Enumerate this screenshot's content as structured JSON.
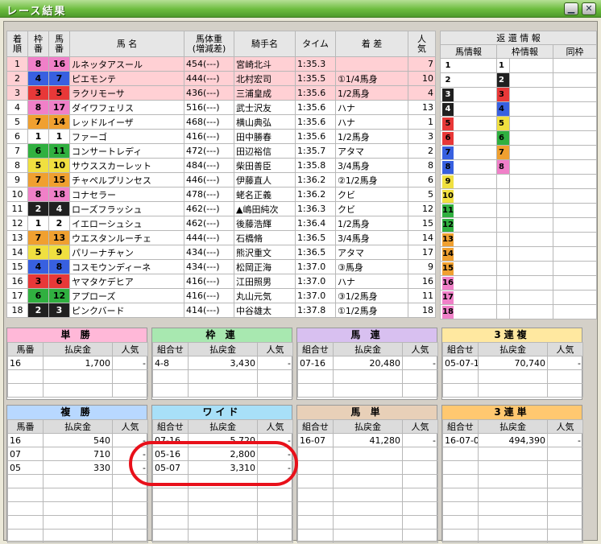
{
  "window": {
    "title": "レース結果",
    "minimize": "▁",
    "close": "✕"
  },
  "results": {
    "headers": {
      "rank": "着\n順",
      "waku": "枠\n番",
      "uma": "馬\n番",
      "name": "馬 名",
      "weight": "馬体重\n(増減差)",
      "jockey": "騎手名",
      "time": "タイム",
      "margin": "着 差",
      "pop": "人\n気"
    },
    "rows": [
      {
        "rank": "1",
        "waku": "8",
        "uma": "16",
        "name": "ルネッタアスール",
        "weight": "454(---)",
        "jockey": "宮崎北斗",
        "time": "1:35.3",
        "margin": "",
        "pop": "7"
      },
      {
        "rank": "2",
        "waku": "4",
        "uma": "7",
        "name": "ピエモンテ",
        "weight": "444(---)",
        "jockey": "北村宏司",
        "time": "1:35.5",
        "margin": "①1/4馬身",
        "pop": "10"
      },
      {
        "rank": "3",
        "waku": "3",
        "uma": "5",
        "name": "ラクリモーサ",
        "weight": "436(---)",
        "jockey": "三浦皇成",
        "time": "1:35.6",
        "margin": "1/2馬身",
        "pop": "4"
      },
      {
        "rank": "4",
        "waku": "8",
        "uma": "17",
        "name": "ダイワフェリス",
        "weight": "516(---)",
        "jockey": "武士沢友",
        "time": "1:35.6",
        "margin": "ハナ",
        "pop": "13"
      },
      {
        "rank": "5",
        "waku": "7",
        "uma": "14",
        "name": "レッドルイーザ",
        "weight": "468(---)",
        "jockey": "横山典弘",
        "time": "1:35.6",
        "margin": "ハナ",
        "pop": "1"
      },
      {
        "rank": "6",
        "waku": "1",
        "uma": "1",
        "name": "ファーゴ",
        "weight": "416(---)",
        "jockey": "田中勝春",
        "time": "1:35.6",
        "margin": "1/2馬身",
        "pop": "3"
      },
      {
        "rank": "7",
        "waku": "6",
        "uma": "11",
        "name": "コンサートレディ",
        "weight": "472(---)",
        "jockey": "田辺裕信",
        "time": "1:35.7",
        "margin": "アタマ",
        "pop": "2"
      },
      {
        "rank": "8",
        "waku": "5",
        "uma": "10",
        "name": "サウススカーレット",
        "weight": "484(---)",
        "jockey": "柴田善臣",
        "time": "1:35.8",
        "margin": "3/4馬身",
        "pop": "8"
      },
      {
        "rank": "9",
        "waku": "7",
        "uma": "15",
        "name": "チャペルプリンセス",
        "weight": "446(---)",
        "jockey": "伊藤直人",
        "time": "1:36.2",
        "margin": "②1/2馬身",
        "pop": "6"
      },
      {
        "rank": "10",
        "waku": "8",
        "uma": "18",
        "name": "コナセラー",
        "weight": "478(---)",
        "jockey": "蛯名正義",
        "time": "1:36.2",
        "margin": "クビ",
        "pop": "5"
      },
      {
        "rank": "11",
        "waku": "2",
        "uma": "4",
        "name": "ローズフラッシュ",
        "weight": "462(---)",
        "jockey": "▲嶋田純次",
        "time": "1:36.3",
        "margin": "クビ",
        "pop": "12"
      },
      {
        "rank": "12",
        "waku": "1",
        "uma": "2",
        "name": "イエローシュシュ",
        "weight": "462(---)",
        "jockey": "後藤浩輝",
        "time": "1:36.4",
        "margin": "1/2馬身",
        "pop": "15"
      },
      {
        "rank": "13",
        "waku": "7",
        "uma": "13",
        "name": "ウエスタンルーチェ",
        "weight": "444(---)",
        "jockey": "石橋脩",
        "time": "1:36.5",
        "margin": "3/4馬身",
        "pop": "14"
      },
      {
        "rank": "14",
        "waku": "5",
        "uma": "9",
        "name": "パリーナチャン",
        "weight": "434(---)",
        "jockey": "熊沢重文",
        "time": "1:36.5",
        "margin": "アタマ",
        "pop": "17"
      },
      {
        "rank": "15",
        "waku": "4",
        "uma": "8",
        "name": "コスモウンディーネ",
        "weight": "434(---)",
        "jockey": "松岡正海",
        "time": "1:37.0",
        "margin": "③馬身",
        "pop": "9"
      },
      {
        "rank": "16",
        "waku": "3",
        "uma": "6",
        "name": "ヤマタケデヒア",
        "weight": "416(---)",
        "jockey": "江田照男",
        "time": "1:37.0",
        "margin": "ハナ",
        "pop": "16"
      },
      {
        "rank": "17",
        "waku": "6",
        "uma": "12",
        "name": "アプローズ",
        "weight": "416(---)",
        "jockey": "丸山元気",
        "time": "1:37.0",
        "margin": "③1/2馬身",
        "pop": "11"
      },
      {
        "rank": "18",
        "waku": "2",
        "uma": "3",
        "name": "ピンクバード",
        "weight": "414(---)",
        "jockey": "中谷雄太",
        "time": "1:37.8",
        "margin": "①1/2馬身",
        "pop": "18"
      }
    ]
  },
  "return_info": {
    "title": "返 還 情 報",
    "col_horse": "馬情報",
    "col_waku": "枠情報",
    "col_same": "同枠",
    "horse_nums": [
      "1",
      "2",
      "3",
      "4",
      "5",
      "6",
      "7",
      "8",
      "9",
      "10",
      "11",
      "12",
      "13",
      "14",
      "15",
      "16",
      "17",
      "18"
    ],
    "waku_nums": [
      "1",
      "2",
      "3",
      "4",
      "5",
      "6",
      "7",
      "8"
    ]
  },
  "payouts": {
    "tansho": {
      "title": "単 勝",
      "h1": "馬番",
      "h2": "払戻金",
      "h3": "人気",
      "rows": [
        {
          "a": "16",
          "b": "1,700",
          "c": "-"
        }
      ]
    },
    "wakuren": {
      "title": "枠 連",
      "h1": "組合せ",
      "h2": "払戻金",
      "h3": "人気",
      "rows": [
        {
          "a": "4-8",
          "b": "3,430",
          "c": "-"
        }
      ]
    },
    "umaren": {
      "title": "馬 連",
      "h1": "組合せ",
      "h2": "払戻金",
      "h3": "人気",
      "rows": [
        {
          "a": "07-16",
          "b": "20,480",
          "c": "-"
        }
      ]
    },
    "sanrenpuku": {
      "title": "3連複",
      "h1": "組合せ",
      "h2": "払戻金",
      "h3": "人気",
      "rows": [
        {
          "a": "05-07-16",
          "b": "70,740",
          "c": "-"
        }
      ]
    },
    "fukusho": {
      "title": "複 勝",
      "h1": "馬番",
      "h2": "払戻金",
      "h3": "人気",
      "rows": [
        {
          "a": "16",
          "b": "540",
          "c": "-"
        },
        {
          "a": "07",
          "b": "710",
          "c": "-"
        },
        {
          "a": "05",
          "b": "330",
          "c": "-"
        }
      ]
    },
    "wide": {
      "title": "ワイド",
      "h1": "組合せ",
      "h2": "払戻金",
      "h3": "人気",
      "rows": [
        {
          "a": "07-16",
          "b": "5,720",
          "c": "-"
        },
        {
          "a": "05-16",
          "b": "2,800",
          "c": "-"
        },
        {
          "a": "05-07",
          "b": "3,310",
          "c": "-"
        }
      ]
    },
    "umatan": {
      "title": "馬 単",
      "h1": "組合せ",
      "h2": "払戻金",
      "h3": "人気",
      "rows": [
        {
          "a": "16-07",
          "b": "41,280",
          "c": "-"
        }
      ]
    },
    "sanrentan": {
      "title": "3連単",
      "h1": "組合せ",
      "h2": "払戻金",
      "h3": "人気",
      "rows": [
        {
          "a": "16-07-05",
          "b": "494,390",
          "c": "-"
        }
      ]
    }
  },
  "colors": {
    "waku": {
      "1": "#ffffff",
      "2": "#202020",
      "3": "#e83838",
      "4": "#3860e0",
      "5": "#f0e040",
      "6": "#30b040",
      "7": "#f0a030",
      "8": "#f080c8"
    },
    "waku_text": {
      "1": "#000000",
      "2": "#ffffff",
      "3": "#000000",
      "4": "#000000",
      "5": "#000000",
      "6": "#000000",
      "7": "#000000",
      "8": "#000000"
    },
    "win_row": "#ffd0d4",
    "block_headers": {
      "tansho": "#ffb8d8",
      "wakuren": "#a8e8b0",
      "umaren": "#d8c0f0",
      "sanrenpuku": "#ffe8a0",
      "fukusho": "#b8d8ff",
      "wide": "#a8e0f8",
      "umatan": "#e8d0b8",
      "sanrentan": "#ffc870"
    },
    "annotation": "#e8101a"
  }
}
